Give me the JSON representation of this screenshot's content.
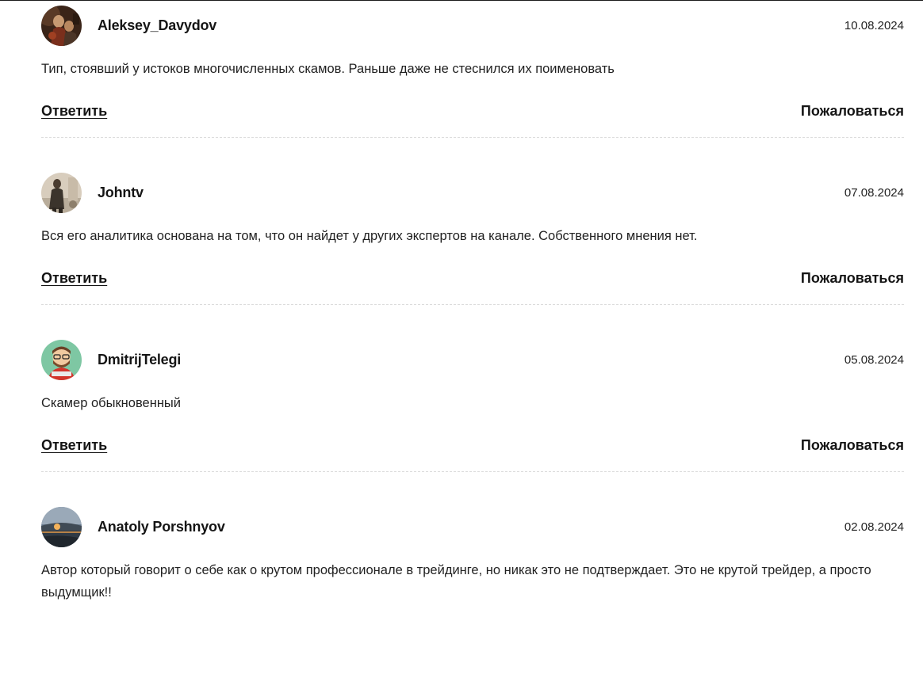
{
  "comments": [
    {
      "author": "Aleksey_Davydov",
      "date": "10.08.2024",
      "text": "Тип, стоявший у истоков многочисленных скамов. Раньше даже не стеснился их поименовать",
      "reply_label": "Ответить",
      "report_label": "Пожаловаться",
      "avatar_icon": "painting-avatar-icon"
    },
    {
      "author": "Johntv",
      "date": "07.08.2024",
      "text": "Вся его аналитика основана на том, что он найдет у других экспертов на канале. Собственного мнения нет.",
      "reply_label": "Ответить",
      "report_label": "Пожаловаться",
      "avatar_icon": "person-photo-avatar-icon"
    },
    {
      "author": "DmitrijTelegi",
      "date": "05.08.2024",
      "text": "Скамер обыкновенный",
      "reply_label": "Ответить",
      "report_label": "Пожаловаться",
      "avatar_icon": "cartoon-man-avatar-icon"
    },
    {
      "author": "Anatoly Porshnyov",
      "date": "02.08.2024",
      "text": "Автор который говорит о себе как о крутом профессионале в трейдинге, но никак это не подтверждает. Это не крутой трейдер, а просто выдумщик!!",
      "avatar_icon": "sunset-landscape-avatar-icon"
    }
  ]
}
